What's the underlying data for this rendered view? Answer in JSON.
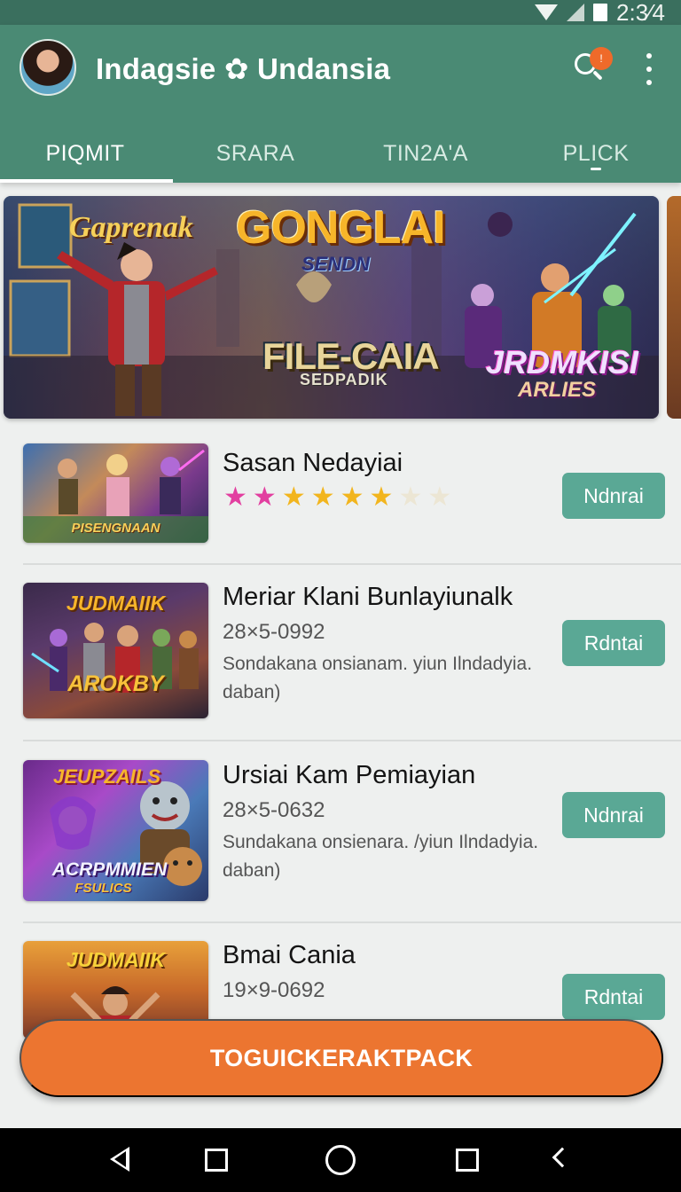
{
  "status_bar": {
    "time": "2:3⁄4"
  },
  "app_bar": {
    "title": "Indagsie ✿ Undansia",
    "notification_count": "!",
    "icons": [
      "avatar",
      "search-icon",
      "more-vert-icon"
    ]
  },
  "tabs": [
    {
      "label": "PIQMIT",
      "active": true
    },
    {
      "label": "SRARA",
      "active": false
    },
    {
      "label": "TIN2A'A",
      "active": false
    },
    {
      "label": "PLICK",
      "active": false
    }
  ],
  "banner": {
    "subtitle": "Gaprenak",
    "title": "GONGLAI",
    "tagline": "SENDN",
    "logo": "FILE-CAIA",
    "logo_sub": "SEDPADIK",
    "right_title": "JRDMKISI",
    "right_sub": "ARLIES"
  },
  "list": [
    {
      "thumb_label": "PISENGNAAN",
      "title": "Sasan Nedayiai",
      "rating": {
        "filled": 6,
        "max": 8
      },
      "star_colors": [
        "#e23fa0",
        "#e23fa0",
        "#f2b51e",
        "#f2b51e",
        "#f2b51e",
        "#f2b51e",
        "#ece6d4",
        "#ece6d4"
      ],
      "action": "Ndnrai"
    },
    {
      "thumb_label": "JUDMAIIK",
      "thumb_label2": "AROKBY",
      "title": "Meriar Klani Bunlayiunalk",
      "subtitle": "28×5-0992",
      "description": "Sondakana onsianam. yiun Ilndadyia. daban)",
      "action": "Rdntai"
    },
    {
      "thumb_label": "JEUPZAILS",
      "thumb_label2": "ACRPMMIEN",
      "thumb_label3": "FSULICS",
      "title": "Ursiai Kam Pemiayian",
      "subtitle": "28×5-0632",
      "description": "Sundakana onsienara. /yiun Ilndadyia. daban)",
      "action": "Ndnrai"
    },
    {
      "thumb_label": "JUDMAIIK",
      "title": "Bmai Cania",
      "subtitle": "19×9-0692",
      "action": "Rdntai"
    }
  ],
  "fab": {
    "label": "TOGUICKERAKTPACK"
  },
  "nav_bar": {
    "icons": [
      "back-triangle-icon",
      "recents-square-icon",
      "home-circle-icon",
      "square-icon",
      "chevron-back-icon"
    ]
  },
  "colors": {
    "primary": "#4a8a74",
    "status_bar": "#3a6f5e",
    "accent": "#ec7530",
    "button": "#5aa895"
  }
}
